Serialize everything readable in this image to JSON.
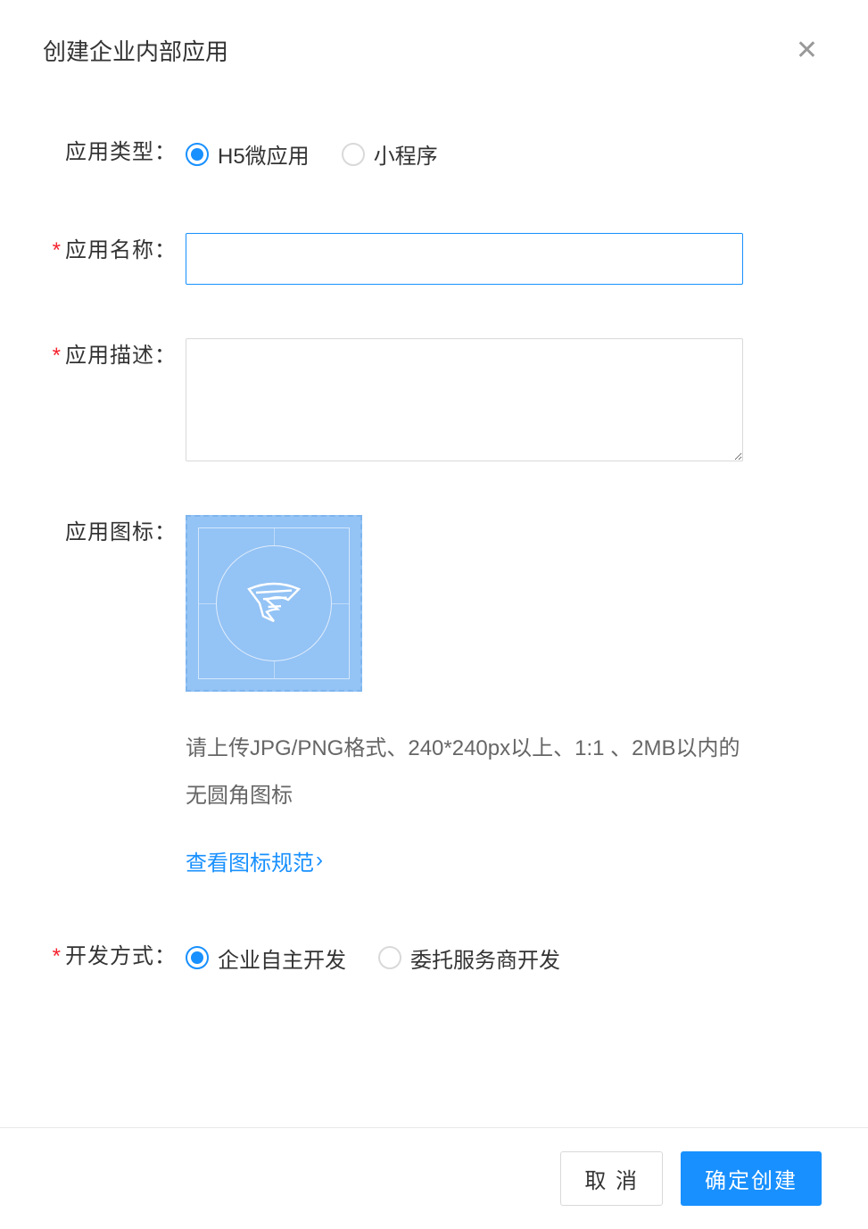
{
  "dialog": {
    "title": "创建企业内部应用"
  },
  "form": {
    "app_type": {
      "label": "应用类型：",
      "option1": "H5微应用",
      "option2": "小程序"
    },
    "app_name": {
      "label": "应用名称：",
      "value": ""
    },
    "app_desc": {
      "label": "应用描述：",
      "value": ""
    },
    "app_icon": {
      "label": "应用图标：",
      "hint": "请上传JPG/PNG格式、240*240px以上、1:1 、2MB以内的无圆角图标",
      "link": "查看图标规范"
    },
    "dev_method": {
      "label": "开发方式：",
      "option1": "企业自主开发",
      "option2": "委托服务商开发"
    }
  },
  "footer": {
    "cancel": "取 消",
    "confirm": "确定创建"
  }
}
